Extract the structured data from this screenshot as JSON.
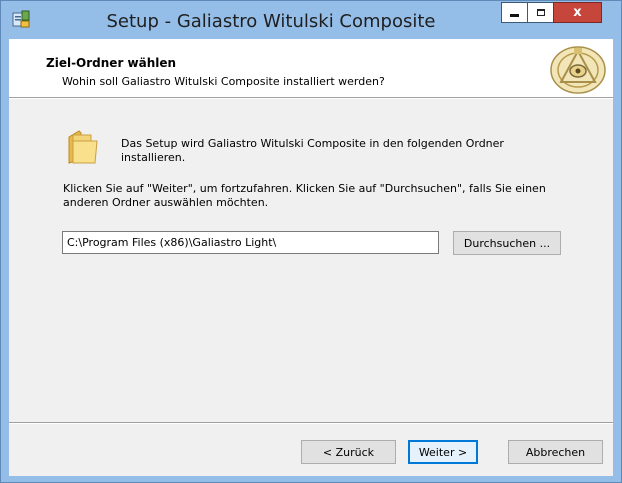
{
  "window": {
    "title": "Setup - Galiastro Witulski Composite",
    "controls": {
      "minimize": "minimize-icon",
      "maximize": "maximize-icon",
      "close": "close-icon",
      "close_glyph": "x"
    },
    "close_color": "#c7463b",
    "frame_color": "#94bde8"
  },
  "header": {
    "title": "Ziel-Ordner wählen",
    "subtitle": "Wohin soll Galiastro Witulski Composite installiert werden?"
  },
  "body": {
    "intro": "Das Setup wird Galiastro Witulski Composite in den folgenden Ordner installieren.",
    "instruction": "Klicken Sie auf \"Weiter\", um fortzufahren. Klicken Sie auf \"Durchsuchen\", falls Sie einen anderen Ordner auswählen möchten.",
    "path_value": "C:\\Program Files (x86)\\Galiastro Light\\",
    "browse_label": "Durchsuchen ..."
  },
  "footer": {
    "back_label": "< Zurück",
    "next_label": "Weiter >",
    "cancel_label": "Abbrechen"
  },
  "icons": {
    "app": "setup-app-icon",
    "logo": "galiastro-logo-icon",
    "folder": "folder-icon"
  }
}
